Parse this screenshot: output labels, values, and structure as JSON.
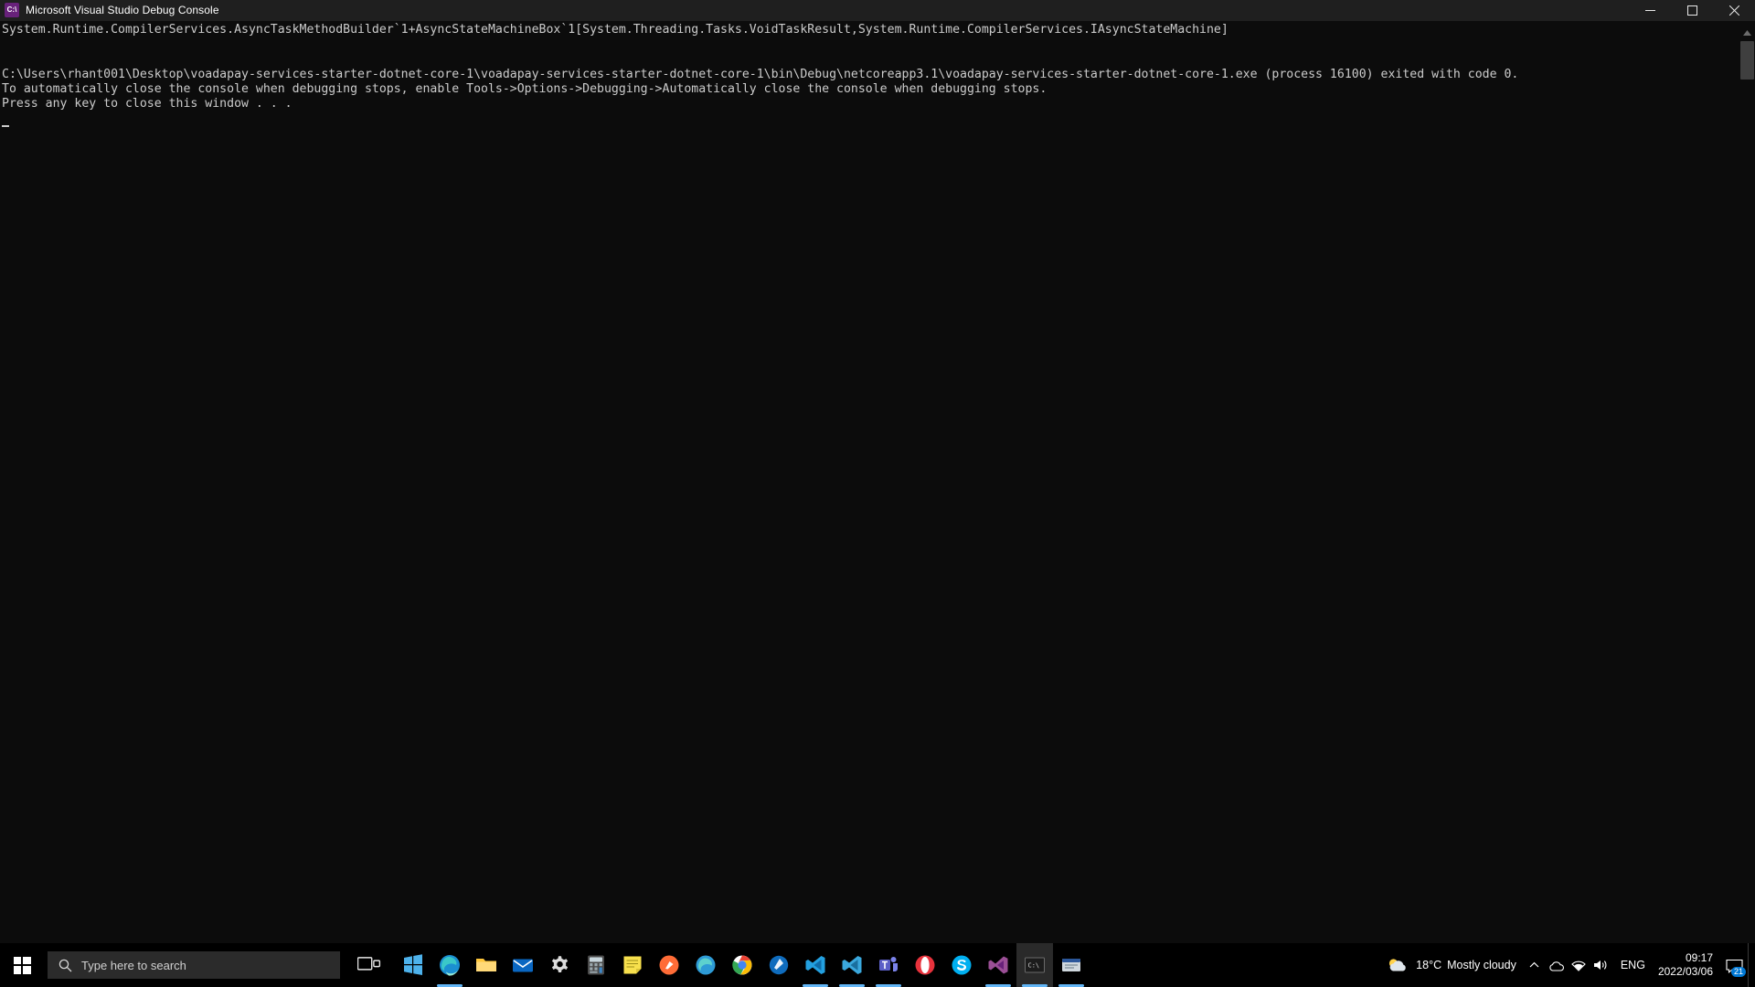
{
  "window": {
    "title": "Microsoft Visual Studio Debug Console",
    "icon_name": "visual-studio-console-icon",
    "icon_glyph": "C:\\",
    "minimize_label": "Minimize",
    "maximize_label": "Maximize",
    "close_label": "Close"
  },
  "console": {
    "lines": [
      "System.Runtime.CompilerServices.AsyncTaskMethodBuilder`1+AsyncStateMachineBox`1[System.Threading.Tasks.VoidTaskResult,System.Runtime.CompilerServices.IAsyncStateMachine]",
      "",
      "",
      "C:\\Users\\rhant001\\Desktop\\voadapay-services-starter-dotnet-core-1\\voadapay-services-starter-dotnet-core-1\\bin\\Debug\\netcoreapp3.1\\voadapay-services-starter-dotnet-core-1.exe (process 16100) exited with code 0.",
      "To automatically close the console when debugging stops, enable Tools->Options->Debugging->Automatically close the console when debugging stops.",
      "Press any key to close this window . . ."
    ],
    "text_color": "#cccccc",
    "background_color": "#0c0c0c"
  },
  "taskbar": {
    "start_label": "Start",
    "search": {
      "placeholder": "Type here to search",
      "value": "Type here to search",
      "icon_name": "search-icon"
    },
    "task_view_label": "Task View",
    "apps": [
      {
        "name": "microsoft-store-icon",
        "label": "Microsoft Store",
        "active": false,
        "running": false,
        "color": "#2d7d9a"
      },
      {
        "name": "microsoft-edge-icon",
        "label": "Microsoft Edge",
        "active": false,
        "running": true,
        "color": "#0f7bbd"
      },
      {
        "name": "file-explorer-icon",
        "label": "File Explorer",
        "active": false,
        "running": false,
        "color": "#ffd04b"
      },
      {
        "name": "mail-icon",
        "label": "Mail",
        "active": false,
        "running": false,
        "color": "#0a67c2"
      },
      {
        "name": "settings-icon",
        "label": "Settings",
        "active": false,
        "running": false,
        "color": "#d6d6d6"
      },
      {
        "name": "calculator-icon",
        "label": "Calculator",
        "active": false,
        "running": false,
        "color": "#5a5a5a"
      },
      {
        "name": "sticky-notes-icon",
        "label": "Sticky Notes",
        "active": false,
        "running": false,
        "color": "#f5d04a"
      },
      {
        "name": "postman-icon",
        "label": "Postman",
        "active": false,
        "running": false,
        "color": "#ff6c37"
      },
      {
        "name": "microsoft-edge-dev-icon",
        "label": "Microsoft Edge Dev",
        "active": false,
        "running": false,
        "color": "#3fa3d8"
      },
      {
        "name": "google-chrome-icon",
        "label": "Google Chrome",
        "active": false,
        "running": false,
        "color": "#4285f4"
      },
      {
        "name": "azure-data-studio-icon",
        "label": "Azure Data Studio",
        "active": false,
        "running": false,
        "color": "#0f6cbd"
      },
      {
        "name": "visual-studio-code-icon",
        "label": "Visual Studio Code",
        "active": false,
        "running": true,
        "color": "#22a0e3"
      },
      {
        "name": "vscode-insiders-icon",
        "label": "Visual Studio Code - Insiders",
        "active": false,
        "running": true,
        "color": "#3ea0da"
      },
      {
        "name": "microsoft-teams-icon",
        "label": "Microsoft Teams",
        "active": false,
        "running": true,
        "color": "#6264a7"
      },
      {
        "name": "opera-icon",
        "label": "Opera",
        "active": false,
        "running": false,
        "color": "#ec3a3a"
      },
      {
        "name": "skype-icon",
        "label": "Skype",
        "active": false,
        "running": false,
        "color": "#00aff0"
      },
      {
        "name": "visual-studio-icon",
        "label": "Visual Studio 2019",
        "active": false,
        "running": true,
        "color": "#9b4f96"
      },
      {
        "name": "debug-console-icon",
        "label": "Microsoft Visual Studio Debug Console",
        "active": true,
        "running": true,
        "color": "#4a4a4a"
      },
      {
        "name": "sql-server-mgmt-icon",
        "label": "SQL Server Management Studio",
        "active": false,
        "running": true,
        "color": "#2b579a"
      }
    ],
    "weather": {
      "icon_name": "cloudy-icon",
      "temperature": "18°C",
      "condition": "Mostly cloudy"
    },
    "tray": {
      "overflow_icon": "chevron-up-icon",
      "onedrive_icon": "onedrive-icon",
      "network_icon": "network-icon",
      "volume_icon": "volume-icon",
      "language": "ENG"
    },
    "clock": {
      "time": "09:17",
      "date": "2022/03/06"
    },
    "notifications": {
      "icon_name": "notification-icon",
      "count": "21"
    },
    "show_desktop_label": "Show desktop"
  }
}
